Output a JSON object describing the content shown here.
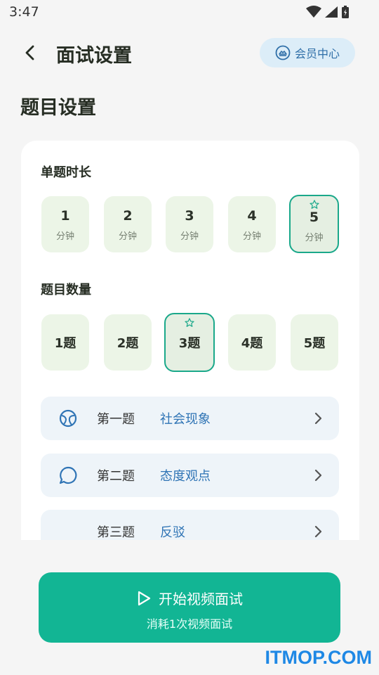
{
  "status": {
    "time": "3:47"
  },
  "header": {
    "title": "面试设置",
    "member_label": "会员中心"
  },
  "section_title": "题目设置",
  "duration": {
    "label": "单题时长",
    "unit": "分钟",
    "options": [
      "1",
      "2",
      "3",
      "4",
      "5"
    ],
    "selected": "5"
  },
  "count": {
    "label": "题目数量",
    "options": [
      "1题",
      "2题",
      "3题",
      "4题",
      "5题"
    ],
    "selected": "3题"
  },
  "questions": [
    {
      "no": "第一题",
      "type": "社会现象",
      "icon": "globe-icon"
    },
    {
      "no": "第二题",
      "type": "态度观点",
      "icon": "speech-bubble-icon"
    },
    {
      "no": "第三题",
      "type": "反驳",
      "icon": ""
    }
  ],
  "start": {
    "label": "开始视频面试",
    "sub": "消耗1次视频面试"
  },
  "watermark": "ITMOP.COM",
  "colors": {
    "accent": "#12b594",
    "option_bg": "#ecf5e7",
    "link_blue": "#2f74b5",
    "member_bg": "#dcedf8"
  }
}
